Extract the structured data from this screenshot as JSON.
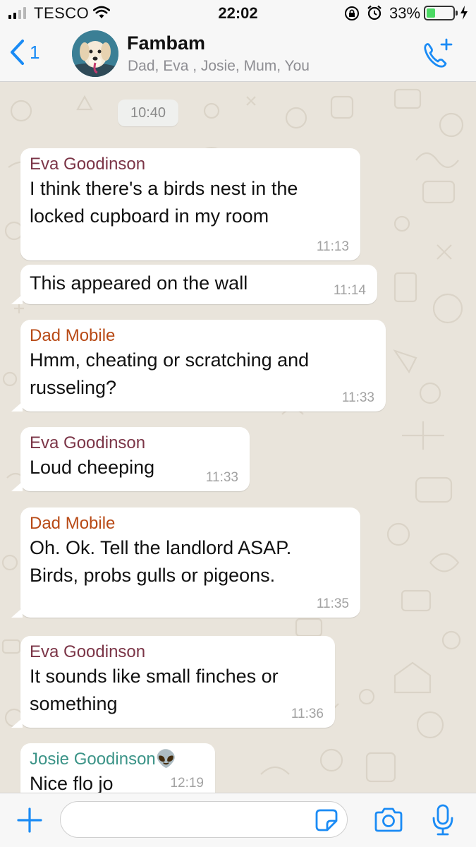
{
  "status_bar": {
    "carrier": "TESCO",
    "time": "22:02",
    "battery_percent": "33%",
    "battery_level": 0.33,
    "signal_bars": 2,
    "icons": [
      "signal-icon",
      "wifi-icon",
      "rotation-lock-icon",
      "alarm-icon",
      "battery-icon",
      "charging-icon"
    ]
  },
  "header": {
    "back_count": "1",
    "title": "Fambam",
    "subtitle": "Dad, Eva , Josie, Mum, You",
    "avatar": "dog-avatar",
    "call_icon": "add-call-icon"
  },
  "chat": {
    "date_pill": "10:40",
    "messages": [
      {
        "sender": "Eva  Goodinson",
        "sender_color": "#7b3547",
        "lines": [
          "I think there's a birds nest in the",
          "locked cupboard in my room"
        ],
        "time": "11:13"
      },
      {
        "sender": "",
        "lines": [
          "This appeared on the wall"
        ],
        "time": "11:14"
      },
      {
        "sender": "Dad Mobile",
        "sender_color": "#b84a16",
        "lines": [
          "Hmm, cheating or scratching and",
          "russeling?"
        ],
        "time": "11:33"
      },
      {
        "sender": "Eva  Goodinson",
        "sender_color": "#7b3547",
        "lines": [
          "Loud cheeping"
        ],
        "time": "11:33"
      },
      {
        "sender": "Dad Mobile",
        "sender_color": "#b84a16",
        "lines": [
          "Oh. Ok. Tell the landlord ASAP.",
          "Birds, probs gulls or pigeons."
        ],
        "time": "11:35"
      },
      {
        "sender": "Eva  Goodinson",
        "sender_color": "#7b3547",
        "lines": [
          "It sounds like small finches or",
          "something"
        ],
        "time": "11:36"
      },
      {
        "sender": "Josie Goodinson👽",
        "sender_color": "#3c9488",
        "lines": [
          "Nice flo jo"
        ],
        "time": "12:19"
      }
    ]
  },
  "input_bar": {
    "placeholder": "",
    "icons": [
      "plus-icon",
      "sticker-icon",
      "camera-icon",
      "microphone-icon"
    ]
  },
  "colors": {
    "accent": "#1a8bf5",
    "chat_background": "#e9e4db",
    "bar_background": "#f7f7f7",
    "battery_fill": "#4cd964"
  }
}
